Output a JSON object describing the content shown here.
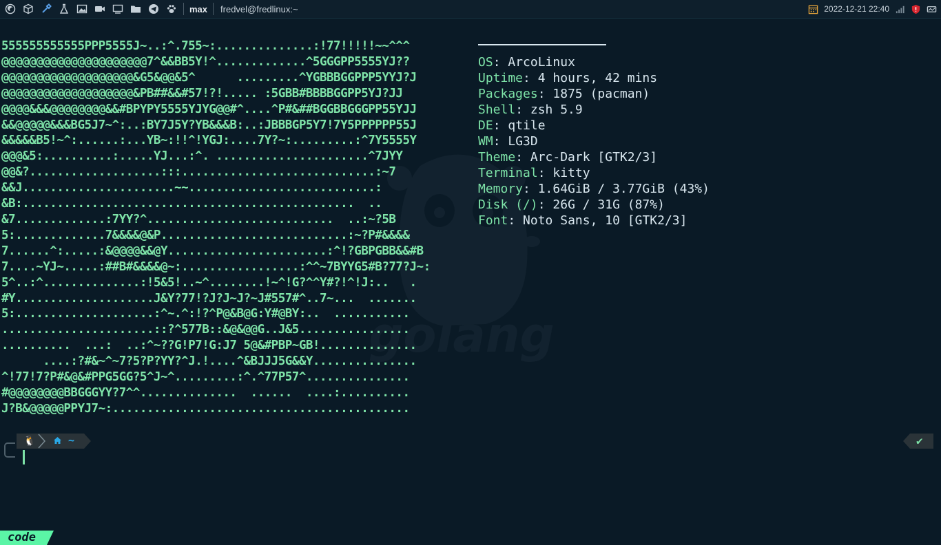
{
  "topbar": {
    "launchers": [
      "firefox-icon",
      "box-icon",
      "color-picker-icon",
      "flask-icon",
      "image-icon",
      "video-camera-icon",
      "monitor-icon",
      "folder-icon",
      "telegram-icon",
      "paw-icon"
    ],
    "layout_name": "max",
    "window_title": "fredvel@fredlinux:~",
    "clock": "2022-12-21 22:40",
    "tray": [
      "calendar-icon",
      "signal-icon",
      "shield-icon",
      "drive-icon"
    ]
  },
  "terminal": {
    "ascii_lines": [
      "555555555555PPP5555J~..:^.755~:..............:!77!!!!!~~^^^",
      "@@@@@@@@@@@@@@@@@@@@@7^&&BB5Y!^.............^5GGGPP5555YJ??",
      "@@@@@@@@@@@@@@@@@@@&G5&@@&5^      .........^YGBBBGGPPP5YYJ?J",
      "@@@@@@@@@@@@@@@@@@@&PB##&&#57!?!..... :5GBB#BBBBGGPP5YJ?JJ",
      "@@@@&&&@@@@@@@@&&#BPYPY5555YJYG@@#^....^P#&##BGGBBGGGPP55YJJ",
      "&&@@@@@&&&BG5J7~^:..:BY7J5Y?YB&&&B:..:JBBBGP5Y7!7Y5PPPPPP55J",
      "&&&&&B5!~^:......:...YB~:!!^!YGJ:....7Y?~:.........:^7Y5555Y",
      "@@@&5:..........:.....YJ...:^. ......................^7JYY",
      "@@&?...................:::............................:~7",
      "&&J......................~~...........................:",
      "&B:................................................  ..",
      "&7.............:7YY?^...........................  ..:~?5B",
      "5:.............7&&&&@&P...........................:~?P#&&&&",
      "7......^:.....:&@@@@&&@Y.......................:^!?GBPGBB&&#B",
      "7....~YJ~.....:##B#&&&&@~:.................:^^~7BYYG5#B?77?J~:",
      "5^..:^..............:!5&5!..~^........!~^!G?^^Y#?!^!J:..   .",
      "#Y....................J&Y?77!?J?J~J?~J#557#^..7~...  .......",
      "5:....................:^~.^:!?^P@&B@G:Y#@BY:..  ...........",
      "......................::?^577B::&@&@@G..J&5................",
      "..........  ...:  ..:^~??G!P7!G:J7 5@&#PBP~GB!..............",
      "      ....:?#&~^~7?5?P?YY?^J.!....^&BJJJ5G&&Y...............",
      "^!77!7?P#&@&#PPG5GG?5^J~^.........:^.^77P57^...............",
      "#@@@@@@@@BBGGGYY?7^^..............  ......  ....:..........",
      "J?B&@@@@@PPYJ7~:..........................................."
    ],
    "info": [
      {
        "key": "OS",
        "value": "ArcoLinux"
      },
      {
        "key": "Uptime",
        "value": "4 hours, 42 mins"
      },
      {
        "key": "Packages",
        "value": "1875 (pacman)"
      },
      {
        "key": "Shell",
        "value": "zsh 5.9"
      },
      {
        "key": "DE",
        "value": "qtile"
      },
      {
        "key": "WM",
        "value": "LG3D"
      },
      {
        "key": "Theme",
        "value": "Arc-Dark [GTK2/3]"
      },
      {
        "key": "Terminal",
        "value": "kitty"
      },
      {
        "key": "Memory",
        "value": "1.64GiB / 3.77GiB (43%)"
      },
      {
        "key": "Disk (/)",
        "value": "26G / 31G (87%)"
      },
      {
        "key": "Font",
        "value": "Noto Sans, 10 [GTK2/3]"
      }
    ],
    "watermark_text": "golang",
    "prompt": {
      "os_icon": "linux-penguin-icon",
      "dir": "~",
      "status": "✔"
    },
    "mode_label": "code"
  },
  "colors": {
    "background": "#0a1a26",
    "accent": "#7ee3a8",
    "mode_tag": "#5bf5a6",
    "dir": "#2aa8e6"
  }
}
